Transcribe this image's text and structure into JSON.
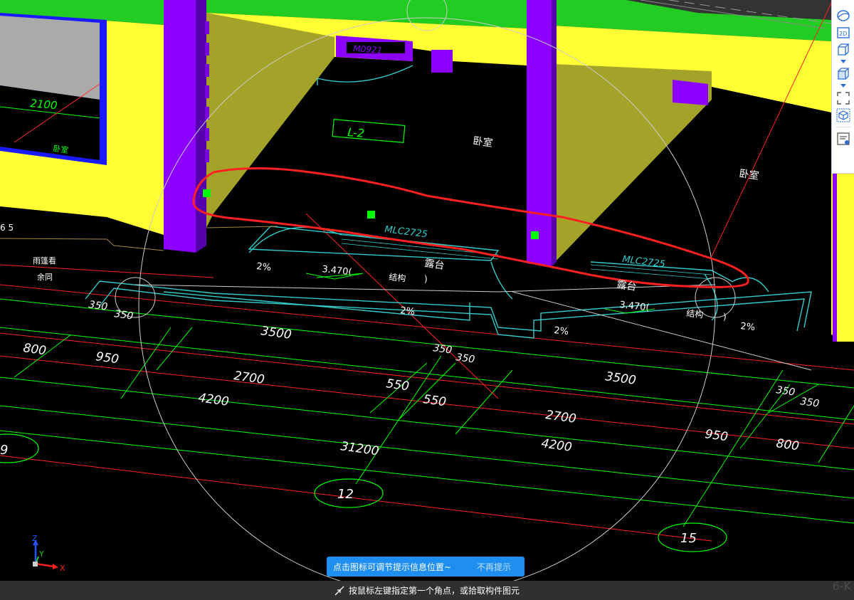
{
  "canvas": {
    "door_tags": [
      "M0921",
      "MLC2725",
      "MLC2725"
    ],
    "beam_tag": "L-2",
    "room_labels": [
      "卧室",
      "卧室",
      "卧室",
      "露台",
      "露台"
    ],
    "left_labels": [
      "雨篷看",
      "余同"
    ],
    "window_width": "2100",
    "partial_label": "6 5",
    "slopes": [
      "2%",
      "2%",
      "2%",
      "2%"
    ],
    "elevations": [
      "3.470(",
      "3.470("
    ],
    "structure_labels": [
      "结构",
      ")",
      "结构",
      ")"
    ],
    "dimensions": [
      "350",
      "350",
      "3500",
      "350",
      "350",
      "800",
      "950",
      "2700",
      "550",
      "550",
      "4200",
      "2700",
      "3500",
      "350",
      "350",
      "950",
      "800",
      "4200",
      "31200"
    ],
    "grid_bubbles": [
      "12",
      "15",
      "9"
    ]
  },
  "toolbar": {
    "items": [
      {
        "icon": "dynamic-observe-icon"
      },
      {
        "icon": "2d-view-icon",
        "text": "2D"
      },
      {
        "icon": "3d-wire-view-icon"
      },
      {
        "icon": "3d-solid-view-icon"
      },
      {
        "icon": "full-screen-icon"
      },
      {
        "icon": "component-display-icon"
      },
      {
        "icon": "properties-panel-icon"
      }
    ]
  },
  "tip": {
    "message": "点击图标可调节提示信息位置~",
    "dismiss": "不再提示"
  },
  "status": {
    "prompt": "按鼠标左键指定第一个角点，或拾取构件图元"
  },
  "axes": {
    "x": "X",
    "y": "Y",
    "z": "Z"
  },
  "watermark": "6-K",
  "colors": {
    "background": "#000000",
    "wall_yellow": "#ffff33",
    "column_purple": "#8b00ff",
    "slab_green": "#22cc22",
    "dimension_green": "#00ff00",
    "annotation_cyan": "#33cccc",
    "markup_red": "#ff2020",
    "tip_blue": "#1e8ef0",
    "status_gray": "#303030"
  }
}
